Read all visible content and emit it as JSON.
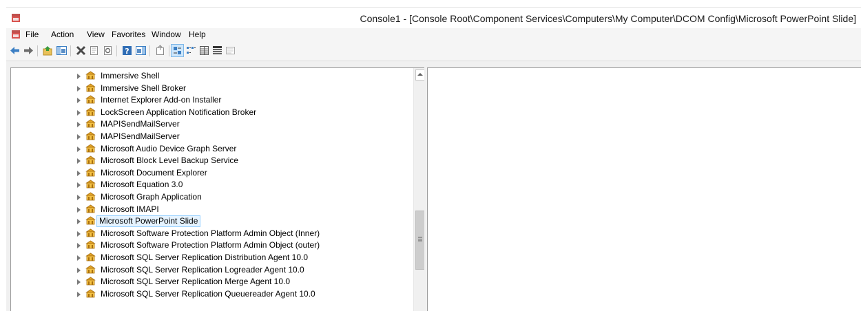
{
  "window": {
    "title": "Console1 - [Console Root\\Component Services\\Computers\\My Computer\\DCOM Config\\Microsoft PowerPoint Slide]"
  },
  "menu": {
    "items": [
      "File",
      "Action",
      "View",
      "Favorites",
      "Window",
      "Help"
    ]
  },
  "toolbar": {
    "buttons": [
      {
        "icon": "back-arrow-icon"
      },
      {
        "icon": "forward-arrow-icon"
      },
      {
        "icon": "up-one-level-icon"
      },
      {
        "icon": "show-hide-console-tree-icon"
      },
      {
        "icon": "delete-icon"
      },
      {
        "icon": "properties-icon"
      },
      {
        "icon": "refresh-icon"
      },
      {
        "icon": "help-icon"
      },
      {
        "icon": "show-hide-action-pane-icon"
      },
      {
        "icon": "export-list-icon"
      },
      {
        "icon": "large-icons-view-icon"
      },
      {
        "icon": "small-icons-view-icon"
      },
      {
        "icon": "list-view-icon"
      },
      {
        "icon": "detail-view-icon"
      },
      {
        "icon": "configure-icon"
      }
    ]
  },
  "tree": {
    "node_icon": "dcom-application-icon",
    "expander_icon": "expand-arrow-icon",
    "selected_index": 12,
    "items": [
      "Immersive Shell",
      "Immersive Shell Broker",
      "Internet Explorer Add-on Installer",
      "LockScreen Application Notification Broker",
      "MAPISendMailServer",
      "MAPISendMailServer",
      "Microsoft Audio Device Graph Server",
      "Microsoft Block Level Backup Service",
      "Microsoft Document Explorer",
      "Microsoft Equation 3.0",
      "Microsoft Graph Application",
      "Microsoft IMAPI",
      "Microsoft PowerPoint Slide",
      "Microsoft Software Protection Platform Admin Object (Inner)",
      "Microsoft Software Protection Platform Admin Object (outer)",
      "Microsoft SQL Server Replication Distribution Agent 10.0",
      "Microsoft SQL Server Replication Logreader Agent 10.0",
      "Microsoft SQL Server Replication Merge Agent 10.0",
      "Microsoft SQL Server Replication Queuereader Agent 10.0"
    ]
  },
  "colors": {
    "selection_fill": "#e5f3ff",
    "selection_border": "#99d1ff",
    "pane_border": "#9d9d9d"
  }
}
